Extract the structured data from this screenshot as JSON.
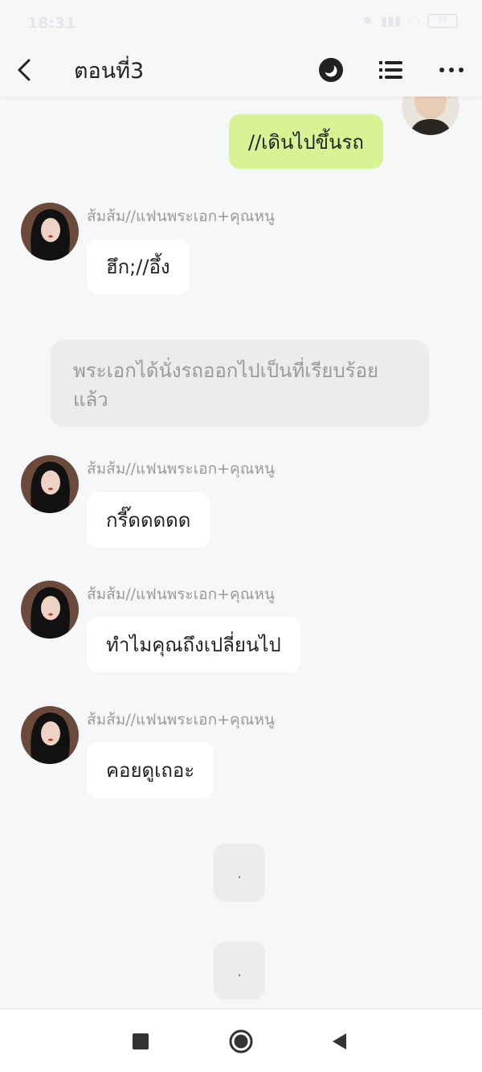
{
  "status": {
    "time": "18:31",
    "battery": "58"
  },
  "header": {
    "title": "ตอนที่3"
  },
  "icons": {
    "back": "back-arrow-icon",
    "theme": "moon-icon",
    "menu": "list-icon",
    "more": "more-icon"
  },
  "messages": {
    "me_1": "//เดินไปขึ้นรถ",
    "other_1": "ฮึก;//อึ้ง",
    "narration": "พระเอกได้นั่งรถออกไปเป็นที่เรียบร้อยแล้ว",
    "other_2": "กรี๊ดดดดด",
    "other_3": "ทำไมคุณถึงเปลี่ยนไป",
    "other_4": "คอยดูเถอะ",
    "dot_1": ".",
    "dot_2": "."
  },
  "sender_name": "ส้มส้ม//แฟนพระเอก+คุณหนู",
  "colors": {
    "background": "#f6f7f9",
    "my_bubble": "#d7f393",
    "other_bubble": "#ffffff",
    "narration_bg": "#ececee",
    "sender_text": "#9a9a9a"
  }
}
